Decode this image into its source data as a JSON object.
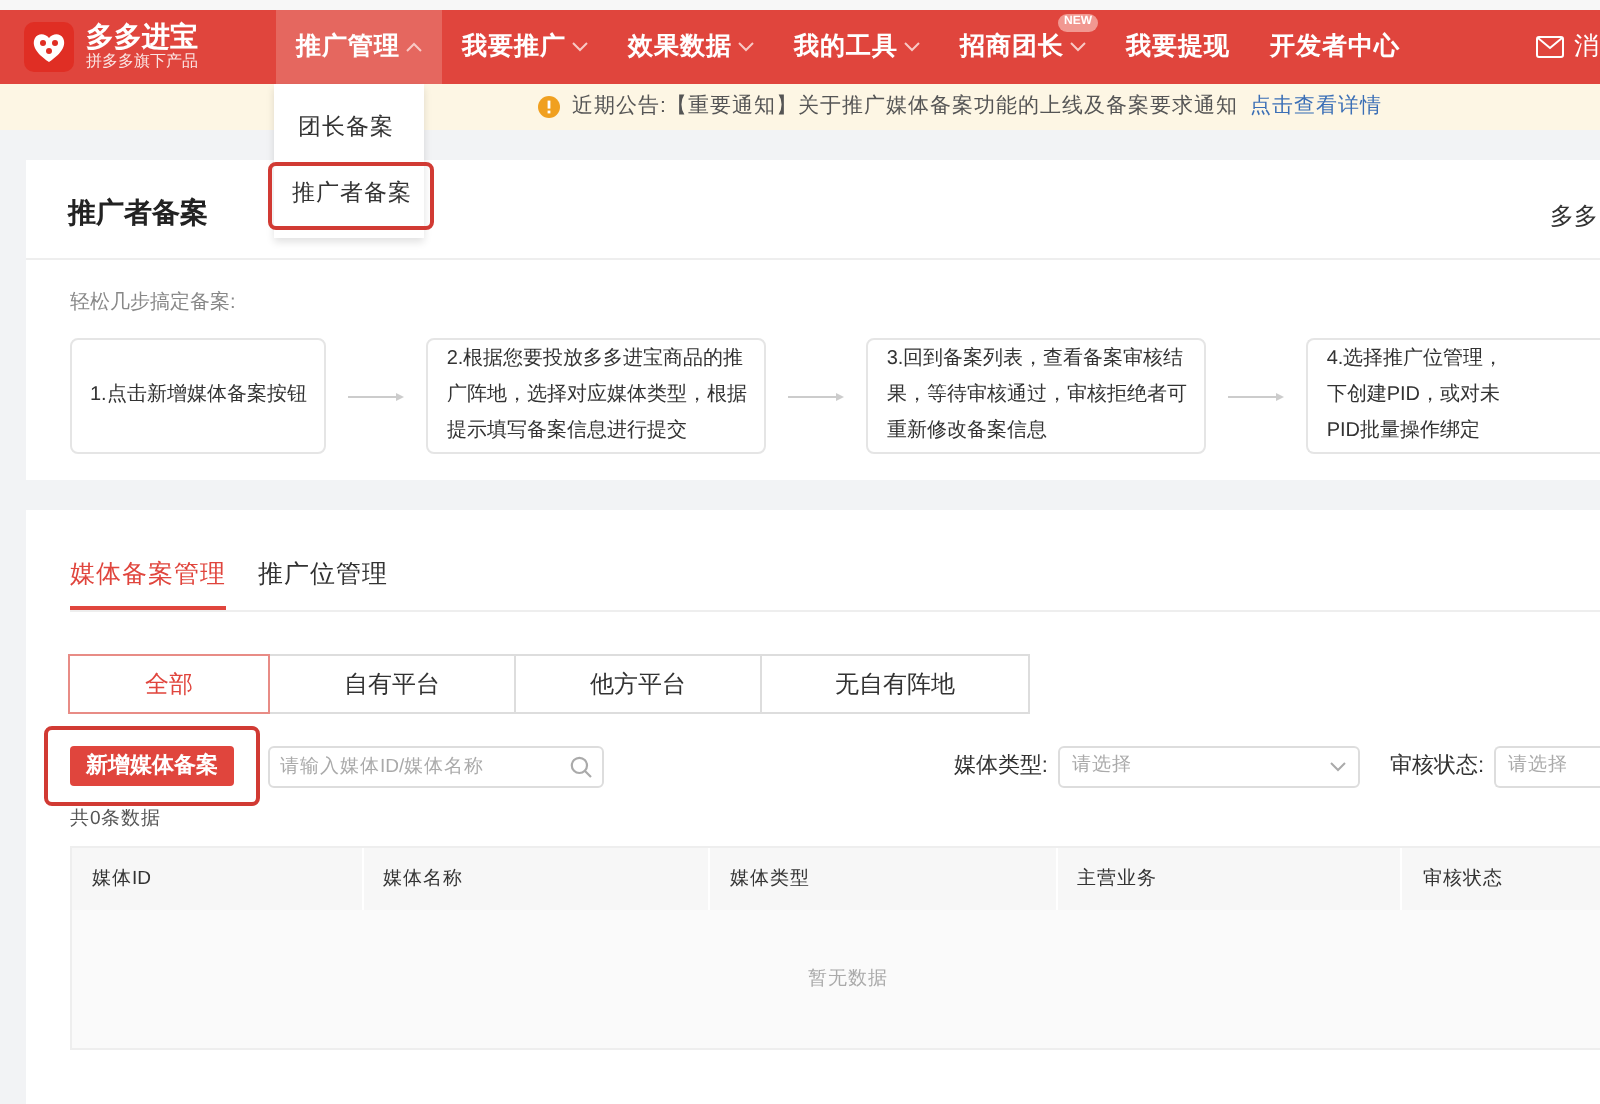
{
  "brand": {
    "name": "多多进宝",
    "tagline": "拼多多旗下产品"
  },
  "nav": [
    {
      "kind": "dropdown",
      "label": "推广管理",
      "selected": true,
      "expanded": true
    },
    {
      "kind": "dropdown",
      "label": "我要推广",
      "selected": false,
      "expanded": false
    },
    {
      "kind": "dropdown",
      "label": "效果数据",
      "selected": false,
      "expanded": false
    },
    {
      "kind": "dropdown",
      "label": "我的工具",
      "selected": false,
      "expanded": false
    },
    {
      "kind": "dropdown",
      "label": "招商团长",
      "selected": false,
      "expanded": false,
      "badge": "NEW"
    },
    {
      "kind": "link",
      "label": "我要提现",
      "selected": false
    },
    {
      "kind": "link",
      "label": "开发者中心",
      "selected": false
    }
  ],
  "nav_right": {
    "label": "消"
  },
  "menu": [
    {
      "label": "团长备案",
      "annotated": false
    },
    {
      "label": "推广者备案",
      "annotated": true
    }
  ],
  "notice": {
    "text": "近期公告:【重要通知】关于推广媒体备案功能的上线及备案要求通知",
    "link": "点击查看详情"
  },
  "intro": {
    "title": "推广者备案",
    "aside": "多多",
    "caption": "轻松几步搞定备案:",
    "steps": [
      {
        "lines": [
          "1.点击新增媒体备案按钮"
        ]
      },
      {
        "lines": [
          "2.根据您要投放多多进宝商品的推",
          "广阵地，选择对应媒体类型，根据",
          "提示填写备案信息进行提交"
        ]
      },
      {
        "lines": [
          "3.回到备案列表，查看备案审核结",
          "果，等待审核通过，审核拒绝者可",
          "重新修改备案信息"
        ]
      },
      {
        "lines": [
          "4.选择推广位管理，",
          "下创建PID，或对未",
          "PID批量操作绑定"
        ]
      }
    ]
  },
  "tabs": [
    {
      "label": "媒体备案管理",
      "selected": true
    },
    {
      "label": "推广位管理",
      "selected": false
    }
  ],
  "segments": [
    {
      "label": "全部",
      "selected": true
    },
    {
      "label": "自有平台",
      "selected": false
    },
    {
      "label": "他方平台",
      "selected": false
    },
    {
      "label": "无自有阵地",
      "selected": false
    }
  ],
  "add_button": {
    "label": "新增媒体备案",
    "annotated": true
  },
  "search": {
    "placeholder": "请输入媒体ID/媒体名称"
  },
  "filters": [
    {
      "label": "媒体类型:",
      "placeholder": "请选择",
      "caret": true
    },
    {
      "label": "审核状态:",
      "placeholder": "请选择",
      "caret": false
    }
  ],
  "count": "共0条数据",
  "table": {
    "columns": [
      "媒体ID",
      "媒体名称",
      "媒体类型",
      "主营业务",
      "审核状态"
    ],
    "empty_text": "暂无数据"
  }
}
